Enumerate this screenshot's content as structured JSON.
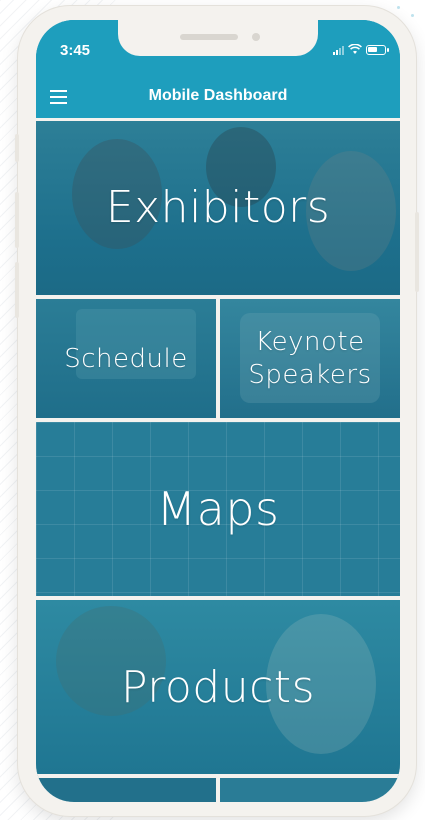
{
  "status_bar": {
    "time": "3:45"
  },
  "nav": {
    "title": "Mobile Dashboard"
  },
  "tiles": {
    "exhibitors": "Exhibitors",
    "schedule": "Schedule",
    "keynote_line1": "Keynote",
    "keynote_line2": "Speakers",
    "maps": "Maps",
    "products": "Products"
  },
  "icons": {
    "menu": "hamburger-menu-icon",
    "signal": "cellular-signal-icon",
    "wifi": "wifi-icon",
    "battery": "battery-icon"
  },
  "colors": {
    "header": "#1e9ebd",
    "tile_overlay": "#1d6f8c",
    "frame": "#f4f2ee"
  }
}
